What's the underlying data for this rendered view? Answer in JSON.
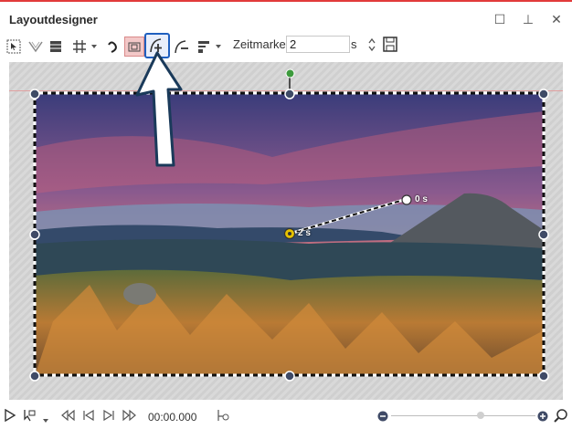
{
  "window": {
    "title": "Layoutdesigner"
  },
  "titlebar_buttons": [
    "maximize-icon",
    "pin-icon",
    "close-icon"
  ],
  "titlebar_glyphs": {
    "maximize": "☐",
    "pin": "⊥",
    "close": "✕"
  },
  "toolbar": {
    "icons": [
      "select-icon",
      "curve-icon",
      "layout-icon",
      "grid-icon",
      "dropdown-arrow-icon",
      "path-icon",
      "frame-icon",
      "add-keyframe-icon",
      "remove-keyframe-icon",
      "align-icon",
      "dropdown-arrow-icon"
    ],
    "zeitmarke_label": "Zeitmarke:",
    "zeitmarke_value": "2",
    "zeitmarke_unit": "s",
    "save_icon": "save-icon"
  },
  "motion_path": {
    "start_label": "2 s",
    "end_label": "0 s"
  },
  "bottom": {
    "timecode": "00:00.000",
    "zoom_out_glyph": "−",
    "zoom_in_glyph": "+"
  },
  "colors": {
    "accent": "#e23a3a",
    "handle": "#3f4a66",
    "rotate_handle": "#3d9a3d",
    "keyframe_active": "#e6c200",
    "highlight": "#1f5fbf"
  }
}
